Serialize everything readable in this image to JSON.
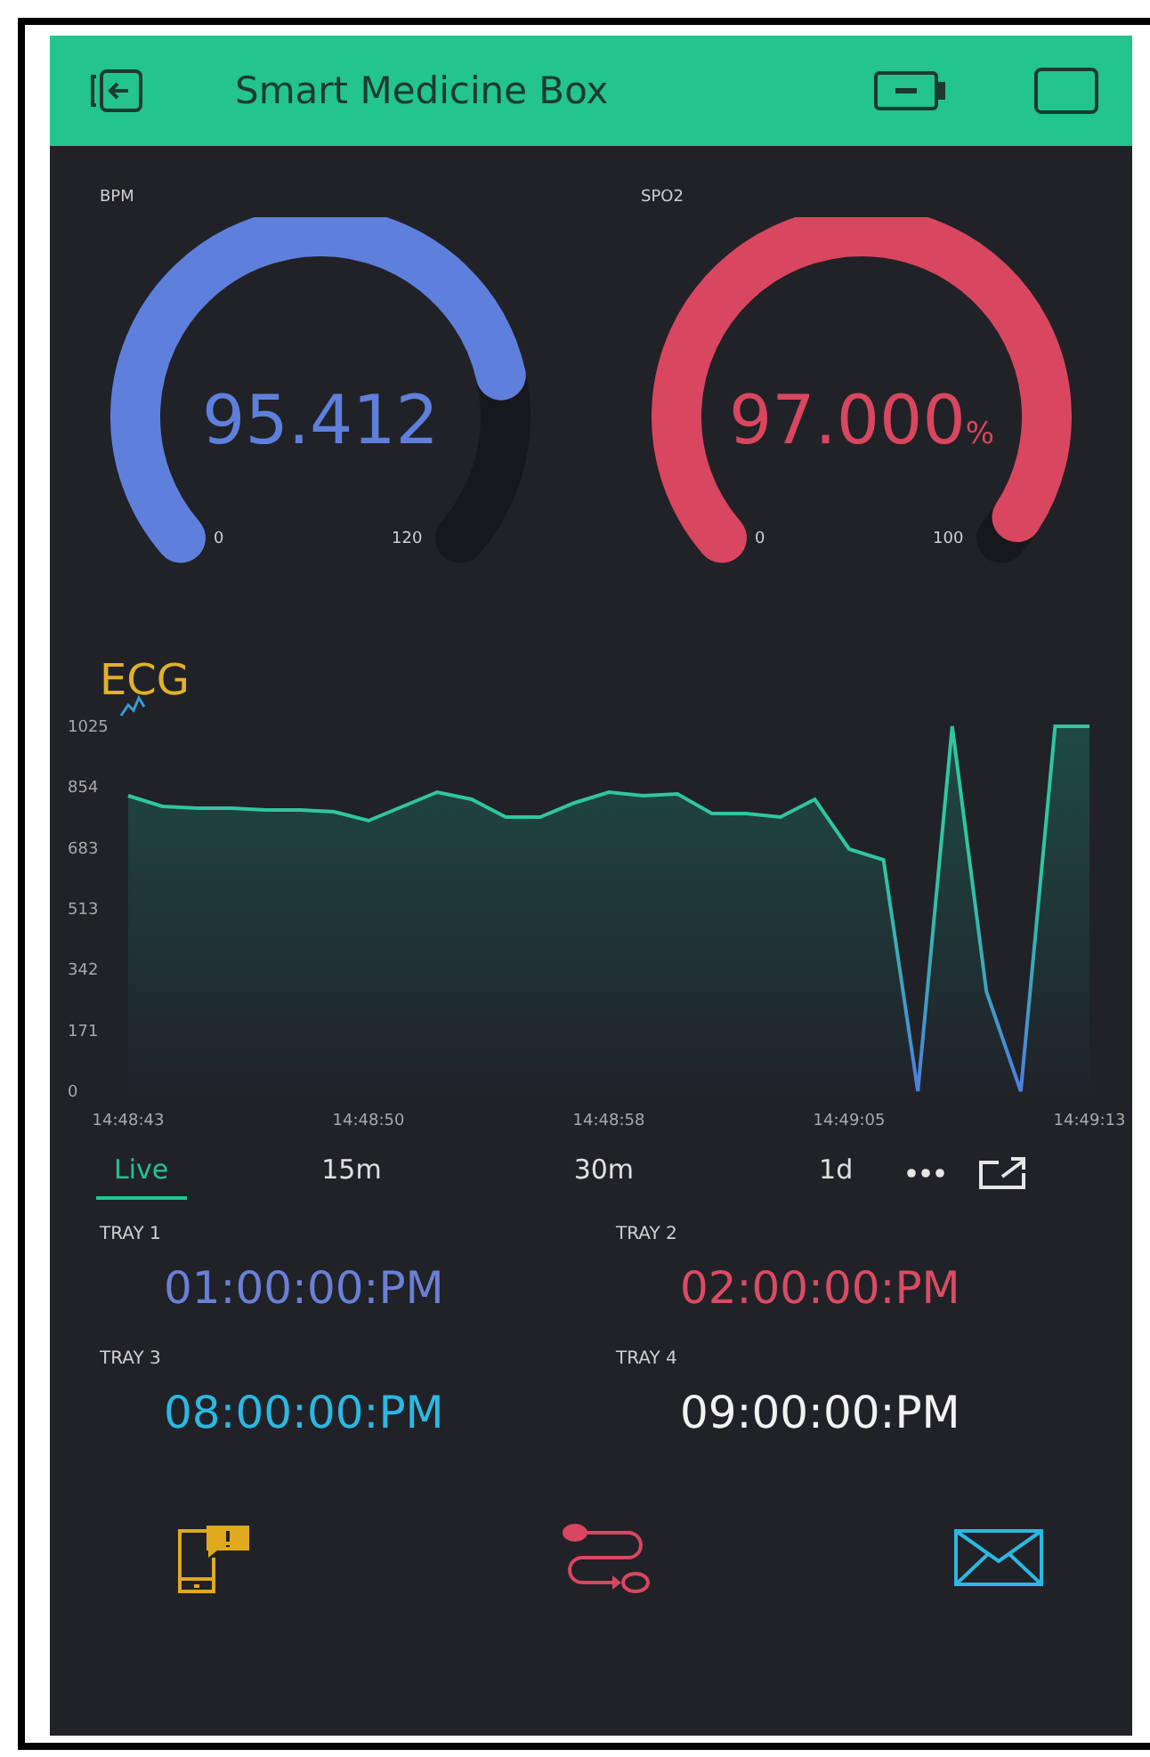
{
  "header": {
    "title": "Smart Medicine Box"
  },
  "gauges": [
    {
      "label": "BPM",
      "value": "95.412",
      "min": "0",
      "max": "120",
      "color": "#5f7fdc"
    },
    {
      "label": "SPO2",
      "value": "97.000",
      "unit": "%",
      "min": "0",
      "max": "100",
      "color": "#d9465f"
    }
  ],
  "ecg": {
    "title": "ECG",
    "chart_data": {
      "type": "area",
      "categories": [
        "14:48:43",
        null,
        null,
        null,
        null,
        null,
        null,
        "14:48:50",
        null,
        null,
        null,
        null,
        null,
        null,
        "14:48:58",
        null,
        null,
        null,
        null,
        null,
        null,
        "14:49:05",
        null,
        null,
        null,
        null,
        null,
        null,
        "14:49:13"
      ],
      "series": [
        {
          "color": "#2fc6a0",
          "values": [
            830,
            800,
            795,
            795,
            790,
            790,
            785,
            760,
            800,
            840,
            820,
            770,
            770,
            810,
            840,
            830,
            835,
            780,
            780,
            770,
            820,
            680,
            650,
            0,
            1025,
            280,
            0,
            1025,
            1025
          ]
        }
      ],
      "ylim": [
        0,
        1025
      ],
      "yticks": [
        0,
        171,
        342,
        513,
        683,
        854,
        1025
      ]
    }
  },
  "ranges": [
    {
      "label": "Live",
      "selected": true
    },
    {
      "label": "15m",
      "selected": false
    },
    {
      "label": "30m",
      "selected": false
    },
    {
      "label": "1d",
      "selected": false
    }
  ],
  "trays": [
    {
      "label": "TRAY 1",
      "time": "01:00:00:PM",
      "color": "#6a7fd6"
    },
    {
      "label": "TRAY 2",
      "time": "02:00:00:PM",
      "color": "#d94c64"
    },
    {
      "label": "TRAY 3",
      "time": "08:00:00:PM",
      "color": "#2bb8e3"
    },
    {
      "label": "TRAY 4",
      "time": "09:00:00:PM",
      "color": "#f2f2f2"
    }
  ]
}
